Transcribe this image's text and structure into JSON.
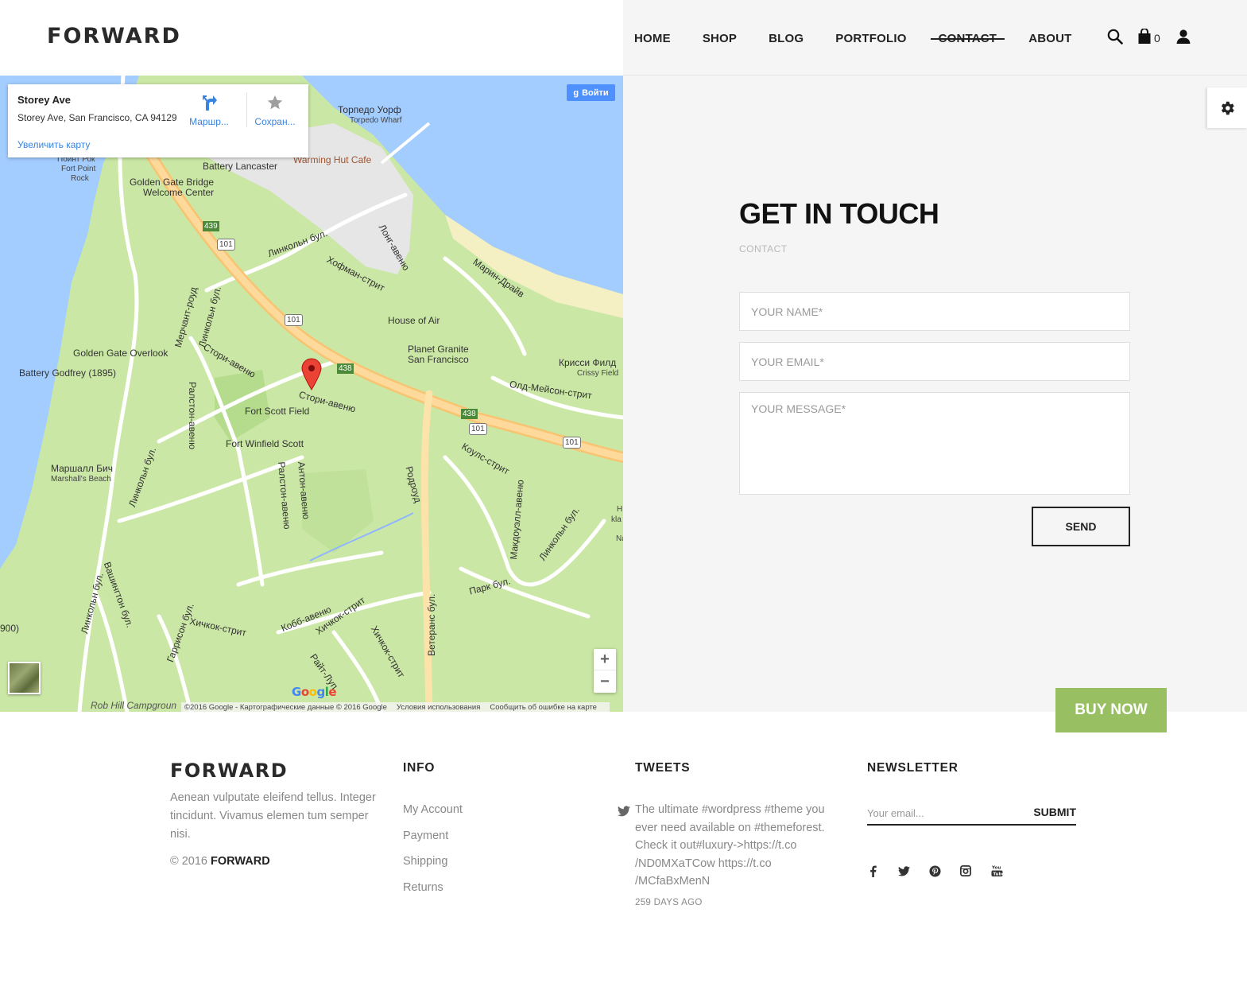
{
  "header": {
    "logo": "FORWARD",
    "nav": [
      "HOME",
      "SHOP",
      "BLOG",
      "PORTFOLIO",
      "CONTACT",
      "ABOUT"
    ],
    "active_nav": "CONTACT",
    "cart_count": "0",
    "icons": [
      "search-icon",
      "cart-icon",
      "user-icon"
    ]
  },
  "map": {
    "info": {
      "title": "Storey Ave",
      "address": "Storey Ave, San Francisco, CA 94129",
      "directions": "Маршр...",
      "save": "Сохран...",
      "enlarge": "Увеличить карту"
    },
    "signin": "Войти",
    "zoom_in": "+",
    "zoom_out": "−",
    "google": "Google",
    "footer": {
      "copyright": "©2016 Google - Картографические данные © 2016 Google",
      "terms": "Условия использования",
      "report": "Сообщить об ошибке на карте"
    },
    "labels": {
      "torpedo_ru": "Торпедо Уорф",
      "torpedo_en": "Torpedo Wharf",
      "point_ru": "Пойнт Рок",
      "point_en1": "Fort Point",
      "point_en2": "Rock",
      "battery_lancaster": "Battery Lancaster",
      "warming_hut": "Warming Hut Cafe",
      "gg_welcome1": "Golden Gate Bridge",
      "gg_welcome2": "Welcome Center",
      "lincoln_ru": "Линкольн бул.",
      "long_ave": "Лонг-авеню",
      "marin_drive": "Марин-Драйв",
      "hoffman": "Хофман-стрит",
      "merchant_rd": "Мерчант-роуд",
      "house_of_air": "House of Air",
      "planet_granite1": "Planet Granite",
      "planet_granite2": "San Francisco",
      "gg_overlook": "Golden Gate Overlook",
      "battery_godfrey": "Battery Godfrey (1895)",
      "storey_ave_ru": "Стори-авеню",
      "crissy_ru": "Крисси Филд",
      "crissy_en": "Crissy Field",
      "old_mason": "Олд-Мейсон-стрит",
      "fort_scott": "Fort Scott Field",
      "ralston": "Ралстон-авеню",
      "fort_winfield": "Fort Winfield Scott",
      "marshall_ru": "Маршалл Бич",
      "marshall_en": "Marshall's Beach",
      "anton": "Антон-авеню",
      "coulls": "Коулс-стрит",
      "rodrua": "Родроуд",
      "macdowell": "Макдоуэлл-авеню",
      "park_blvd": "Парк бул.",
      "cobb": "Кобб-авеню",
      "hitchcock": "Хичкок-стрит",
      "washington": "Вашингтон бул.",
      "harrison": "Гаррисон бул.",
      "wright": "Райт-Луп",
      "veterans": "Ветеранс бул.",
      "rob_hill": "Rob Hill Campgroun",
      "paren_900": "900)",
      "route_101": "101",
      "route_439": "439",
      "route_438": "438",
      "edge_h": "Н",
      "edge_kla": "kla",
      "edge_na": "Na"
    }
  },
  "contact": {
    "title": "GET IN TOUCH",
    "subtitle": "CONTACT",
    "name_placeholder": "YOUR NAME*",
    "email_placeholder": "YOUR EMAIL*",
    "message_placeholder": "YOUR MESSAGE*",
    "send": "SEND",
    "buy_now": "BUY NOW",
    "settings_icon": "gear-icon"
  },
  "footer": {
    "logo": "FORWARD",
    "about": "Aenean vulputate eleifend tellus. Integer tincidunt. Vivamus elemen tum semper nisi.",
    "copyright_prefix": "© 2016",
    "copyright_brand": "FORWARD",
    "info_heading": "INFO",
    "info_links": [
      "My Account",
      "Payment",
      "Shipping",
      "Returns"
    ],
    "tweets_heading": "TWEETS",
    "tweet_text": "The ultimate #wordpress #theme you ever need available on #themeforest. Check it out#luxury->https://t.co /ND0MXaTCow https://t.co /MCfaBxMenN",
    "tweet_time": "259 DAYS AGO",
    "newsletter_heading": "NEWSLETTER",
    "newsletter_placeholder": "Your email...",
    "newsletter_submit": "SUBMIT",
    "socials": [
      "facebook-icon",
      "twitter-icon",
      "pinterest-icon",
      "instagram-icon",
      "youtube-icon"
    ]
  }
}
